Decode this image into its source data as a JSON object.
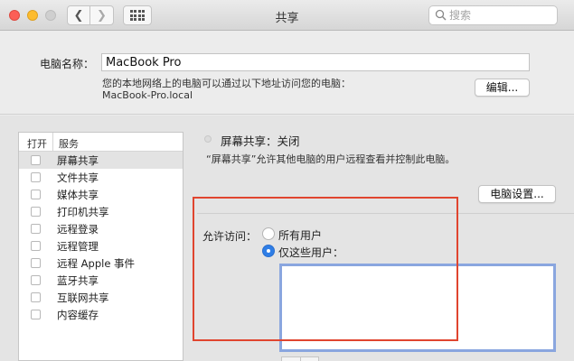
{
  "window": {
    "title": "共享",
    "search_placeholder": "搜索"
  },
  "computer": {
    "name_label": "电脑名称：",
    "name_value": "MacBook Pro",
    "desc_line1": "您的本地网络上的电脑可以通过以下地址访问您的电脑：",
    "desc_line2": "MacBook-Pro.local",
    "edit_button": "编辑..."
  },
  "services": {
    "header_on": "打开",
    "header_service": "服务",
    "items": [
      {
        "label": "屏幕共享",
        "checked": false,
        "selected": true
      },
      {
        "label": "文件共享",
        "checked": false,
        "selected": false
      },
      {
        "label": "媒体共享",
        "checked": false,
        "selected": false
      },
      {
        "label": "打印机共享",
        "checked": false,
        "selected": false
      },
      {
        "label": "远程登录",
        "checked": false,
        "selected": false
      },
      {
        "label": "远程管理",
        "checked": false,
        "selected": false
      },
      {
        "label": "远程 Apple 事件",
        "checked": false,
        "selected": false
      },
      {
        "label": "蓝牙共享",
        "checked": false,
        "selected": false
      },
      {
        "label": "互联网共享",
        "checked": false,
        "selected": false
      },
      {
        "label": "内容缓存",
        "checked": false,
        "selected": false
      }
    ]
  },
  "detail": {
    "status": "屏幕共享：关闭",
    "status_desc": "“屏幕共享”允许其他电脑的用户远程查看并控制此电脑。",
    "settings_button": "电脑设置...",
    "access_label": "允许访问：",
    "option_all": "所有用户",
    "option_only": "仅这些用户：",
    "selected_option": "option_only"
  },
  "colors": {
    "accent": "#2f7ee6",
    "annotation_red": "#e0452f",
    "list_focus": "#8aa6df"
  }
}
